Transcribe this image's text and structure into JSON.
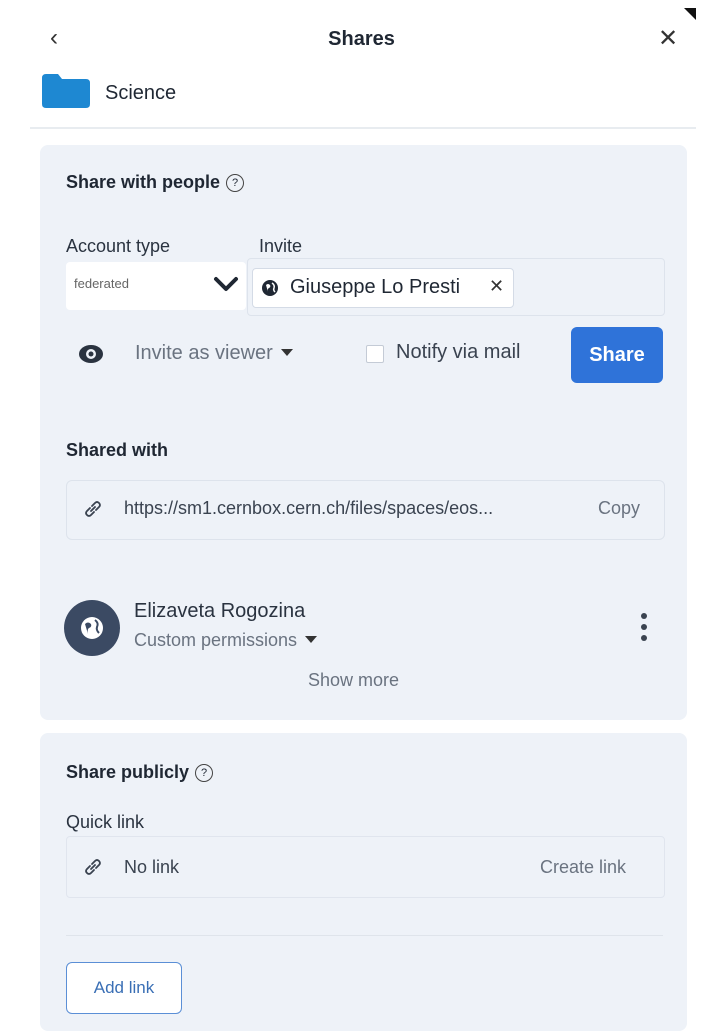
{
  "header": {
    "back_icon": "chevron-left-icon",
    "title": "Shares",
    "close_icon": "close-icon",
    "folder_name": "Science",
    "folder_color": "#1e88d2"
  },
  "share_with_people": {
    "heading": "Share with people",
    "account_type_label": "Account type",
    "account_type_value": "federated",
    "invite_label": "Invite",
    "invitee_chip": "Giuseppe Lo Presti",
    "invite_role": "Invite as viewer",
    "notify_label": "Notify via mail",
    "notify_checked": false,
    "share_button": "Share",
    "accent_color": "#2f73d9"
  },
  "shared_with": {
    "heading": "Shared with",
    "link_url": "https://sm1.cernbox.cern.ch/files/spaces/eos...",
    "copy_label": "Copy",
    "users": [
      {
        "name": "Elizaveta Rogozina",
        "permissions": "Custom permissions"
      }
    ],
    "show_more": "Show more"
  },
  "share_publicly": {
    "heading": "Share publicly",
    "quick_link_label": "Quick link",
    "no_link": "No link",
    "create_link": "Create link",
    "add_link_button": "Add link"
  }
}
